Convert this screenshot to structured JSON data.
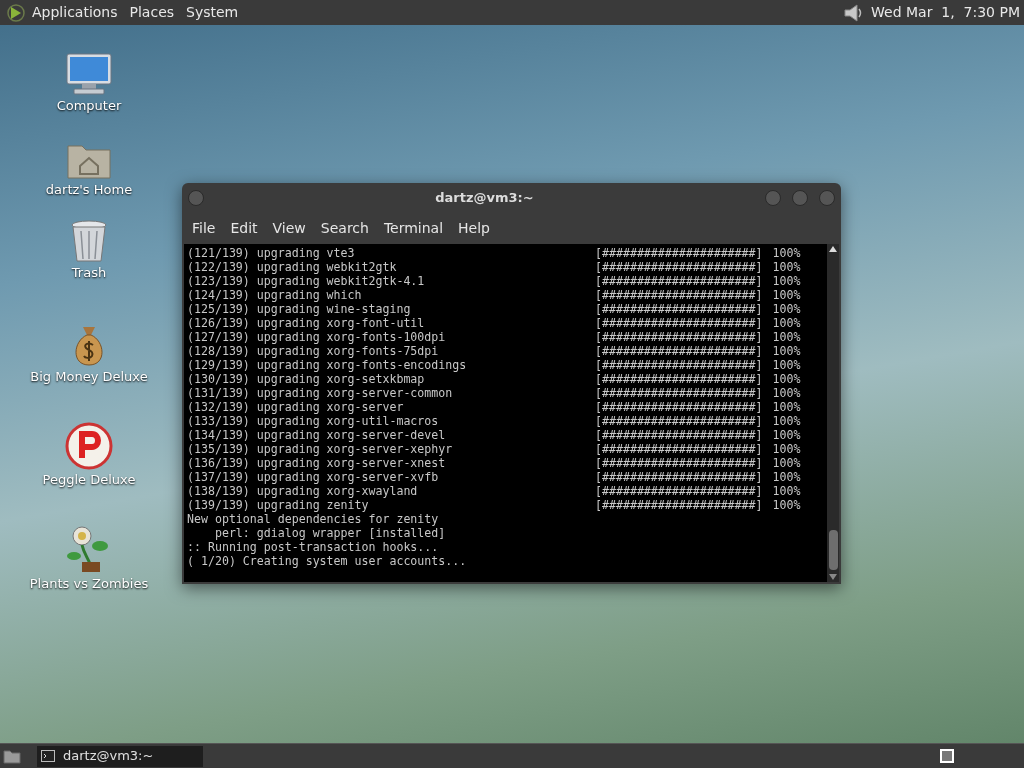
{
  "top_panel": {
    "menus": [
      "Applications",
      "Places",
      "System"
    ],
    "clock": "Wed Mar  1,  7:30 PM"
  },
  "desktop_icons": [
    {
      "kind": "computer",
      "label": "Computer"
    },
    {
      "kind": "home",
      "label": "dartz's Home"
    },
    {
      "kind": "trash",
      "label": "Trash"
    },
    {
      "kind": "money",
      "label": "Big Money Deluxe"
    },
    {
      "kind": "peggle",
      "label": "Peggle Deluxe"
    },
    {
      "kind": "plant",
      "label": "Plants vs Zombies"
    }
  ],
  "terminal": {
    "title": "dartz@vm3:~",
    "menu": [
      "File",
      "Edit",
      "View",
      "Search",
      "Terminal",
      "Help"
    ],
    "lines": [
      {
        "kind": "progress",
        "text": "(121/139) upgrading vte3",
        "bar": "[######################]",
        "percent": "100%"
      },
      {
        "kind": "progress",
        "text": "(122/139) upgrading webkit2gtk",
        "bar": "[######################]",
        "percent": "100%"
      },
      {
        "kind": "progress",
        "text": "(123/139) upgrading webkit2gtk-4.1",
        "bar": "[######################]",
        "percent": "100%"
      },
      {
        "kind": "progress",
        "text": "(124/139) upgrading which",
        "bar": "[######################]",
        "percent": "100%"
      },
      {
        "kind": "progress",
        "text": "(125/139) upgrading wine-staging",
        "bar": "[######################]",
        "percent": "100%"
      },
      {
        "kind": "progress",
        "text": "(126/139) upgrading xorg-font-util",
        "bar": "[######################]",
        "percent": "100%"
      },
      {
        "kind": "progress",
        "text": "(127/139) upgrading xorg-fonts-100dpi",
        "bar": "[######################]",
        "percent": "100%"
      },
      {
        "kind": "progress",
        "text": "(128/139) upgrading xorg-fonts-75dpi",
        "bar": "[######################]",
        "percent": "100%"
      },
      {
        "kind": "progress",
        "text": "(129/139) upgrading xorg-fonts-encodings",
        "bar": "[######################]",
        "percent": "100%"
      },
      {
        "kind": "progress",
        "text": "(130/139) upgrading xorg-setxkbmap",
        "bar": "[######################]",
        "percent": "100%"
      },
      {
        "kind": "progress",
        "text": "(131/139) upgrading xorg-server-common",
        "bar": "[######################]",
        "percent": "100%"
      },
      {
        "kind": "progress",
        "text": "(132/139) upgrading xorg-server",
        "bar": "[######################]",
        "percent": "100%"
      },
      {
        "kind": "progress",
        "text": "(133/139) upgrading xorg-util-macros",
        "bar": "[######################]",
        "percent": "100%"
      },
      {
        "kind": "progress",
        "text": "(134/139) upgrading xorg-server-devel",
        "bar": "[######################]",
        "percent": "100%"
      },
      {
        "kind": "progress",
        "text": "(135/139) upgrading xorg-server-xephyr",
        "bar": "[######################]",
        "percent": "100%"
      },
      {
        "kind": "progress",
        "text": "(136/139) upgrading xorg-server-xnest",
        "bar": "[######################]",
        "percent": "100%"
      },
      {
        "kind": "progress",
        "text": "(137/139) upgrading xorg-server-xvfb",
        "bar": "[######################]",
        "percent": "100%"
      },
      {
        "kind": "progress",
        "text": "(138/139) upgrading xorg-xwayland",
        "bar": "[######################]",
        "percent": "100%"
      },
      {
        "kind": "progress",
        "text": "(139/139) upgrading zenity",
        "bar": "[######################]",
        "percent": "100%"
      },
      {
        "kind": "plain",
        "text": "New optional dependencies for zenity"
      },
      {
        "kind": "plain",
        "text": "    perl: gdialog wrapper [installed]"
      },
      {
        "kind": "plain",
        "text": ":: Running post-transaction hooks..."
      },
      {
        "kind": "plain",
        "text": "( 1/20) Creating system user accounts..."
      }
    ]
  },
  "taskbar": {
    "windows": [
      {
        "title": "dartz@vm3:~",
        "selected": true
      }
    ]
  }
}
